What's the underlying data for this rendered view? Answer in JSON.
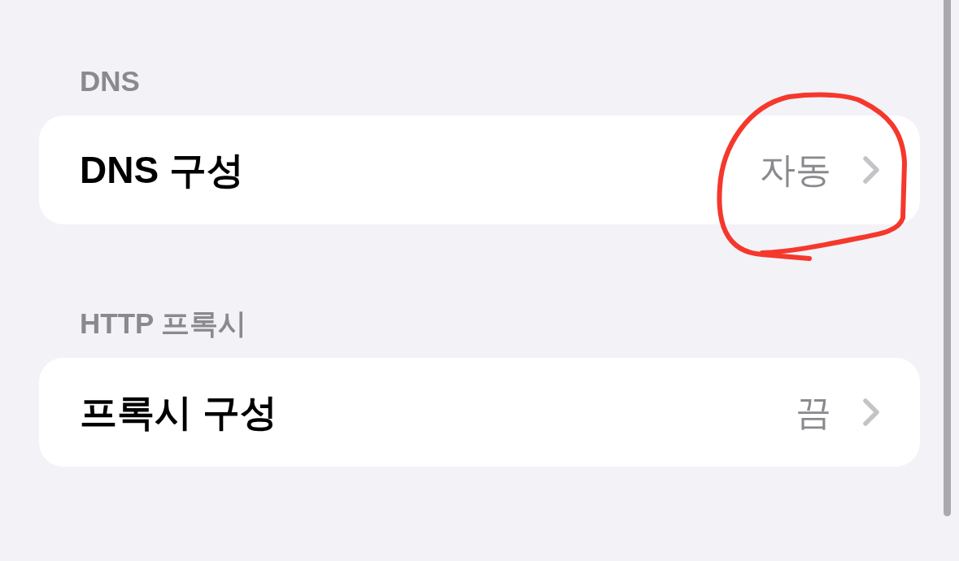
{
  "sections": [
    {
      "header": "DNS",
      "rows": [
        {
          "label": "DNS 구성",
          "value": "자동",
          "circled": true
        }
      ]
    },
    {
      "header": "HTTP 프록시",
      "rows": [
        {
          "label": "프록시 구성",
          "value": "끔",
          "circled": false
        }
      ]
    }
  ]
}
